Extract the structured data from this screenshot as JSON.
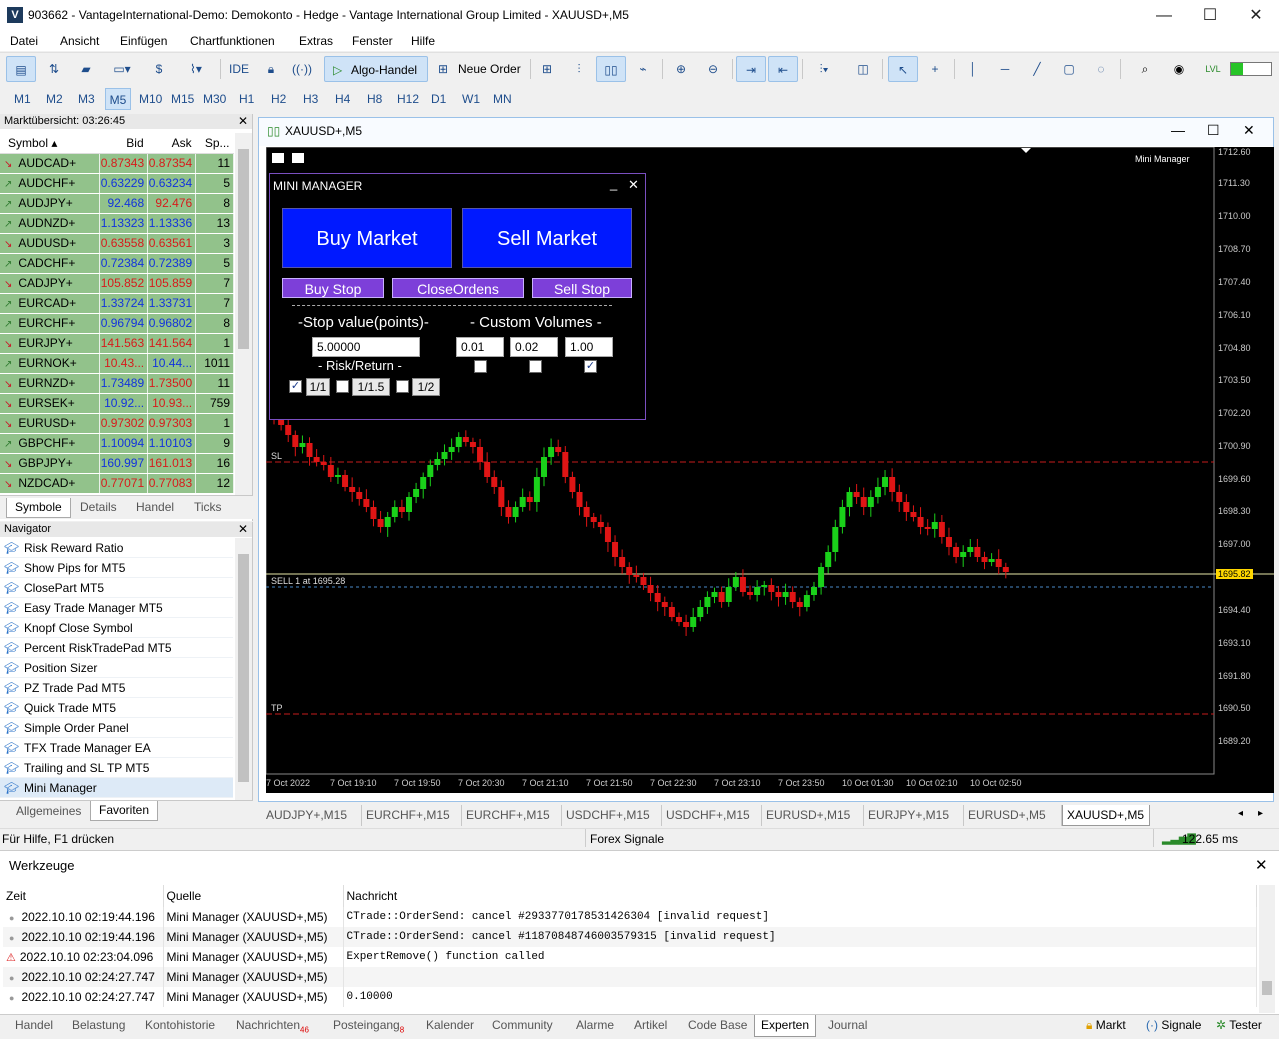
{
  "window": {
    "title": "903662 - VantageInternational-Demo: Demokonto - Hedge - Vantage International Group Limited - XAUUSD+,M5",
    "logo": "V"
  },
  "menu": [
    "Datei",
    "Ansicht",
    "Einfügen",
    "Chartfunktionen",
    "Extras",
    "Fenster",
    "Hilfe"
  ],
  "toolbar": {
    "ide": "IDE",
    "algo": "Algo-Handel",
    "neworder": "Neue Order"
  },
  "timeframes": [
    "M1",
    "M2",
    "M3",
    "M5",
    "M10",
    "M15",
    "M30",
    "H1",
    "H2",
    "H3",
    "H4",
    "H8",
    "H12",
    "D1",
    "W1",
    "MN"
  ],
  "market_watch": {
    "header": "Marktübersicht: 03:26:45",
    "columns": [
      "Symbol",
      "Bid",
      "Ask",
      "Sp..."
    ],
    "rows": [
      {
        "dir": "dn",
        "symbol": "AUDCAD+",
        "bid": "0.87343",
        "ask": "0.87354",
        "spread": "11",
        "bc": "dn",
        "ac": "dn"
      },
      {
        "dir": "up",
        "symbol": "AUDCHF+",
        "bid": "0.63229",
        "ask": "0.63234",
        "spread": "5",
        "bc": "up",
        "ac": "up"
      },
      {
        "dir": "up",
        "symbol": "AUDJPY+",
        "bid": "92.468",
        "ask": "92.476",
        "spread": "8",
        "bc": "up",
        "ac": "dn"
      },
      {
        "dir": "up",
        "symbol": "AUDNZD+",
        "bid": "1.13323",
        "ask": "1.13336",
        "spread": "13",
        "bc": "up",
        "ac": "up"
      },
      {
        "dir": "dn",
        "symbol": "AUDUSD+",
        "bid": "0.63558",
        "ask": "0.63561",
        "spread": "3",
        "bc": "dn",
        "ac": "dn"
      },
      {
        "dir": "up",
        "symbol": "CADCHF+",
        "bid": "0.72384",
        "ask": "0.72389",
        "spread": "5",
        "bc": "up",
        "ac": "up"
      },
      {
        "dir": "dn",
        "symbol": "CADJPY+",
        "bid": "105.852",
        "ask": "105.859",
        "spread": "7",
        "bc": "dn",
        "ac": "dn"
      },
      {
        "dir": "up",
        "symbol": "EURCAD+",
        "bid": "1.33724",
        "ask": "1.33731",
        "spread": "7",
        "bc": "up",
        "ac": "up"
      },
      {
        "dir": "up",
        "symbol": "EURCHF+",
        "bid": "0.96794",
        "ask": "0.96802",
        "spread": "8",
        "bc": "up",
        "ac": "up"
      },
      {
        "dir": "dn",
        "symbol": "EURJPY+",
        "bid": "141.563",
        "ask": "141.564",
        "spread": "1",
        "bc": "dn",
        "ac": "dn"
      },
      {
        "dir": "up",
        "symbol": "EURNOK+",
        "bid": "10.43...",
        "ask": "10.44...",
        "spread": "1011",
        "bc": "dn",
        "ac": "up"
      },
      {
        "dir": "dn",
        "symbol": "EURNZD+",
        "bid": "1.73489",
        "ask": "1.73500",
        "spread": "11",
        "bc": "up",
        "ac": "dn"
      },
      {
        "dir": "dn",
        "symbol": "EURSEK+",
        "bid": "10.92...",
        "ask": "10.93...",
        "spread": "759",
        "bc": "up",
        "ac": "dn"
      },
      {
        "dir": "dn",
        "symbol": "EURUSD+",
        "bid": "0.97302",
        "ask": "0.97303",
        "spread": "1",
        "bc": "dn",
        "ac": "dn"
      },
      {
        "dir": "up",
        "symbol": "GBPCHF+",
        "bid": "1.10094",
        "ask": "1.10103",
        "spread": "9",
        "bc": "up",
        "ac": "up"
      },
      {
        "dir": "dn",
        "symbol": "GBPJPY+",
        "bid": "160.997",
        "ask": "161.013",
        "spread": "16",
        "bc": "up",
        "ac": "dn"
      },
      {
        "dir": "dn",
        "symbol": "NZDCAD+",
        "bid": "0.77071",
        "ask": "0.77083",
        "spread": "12",
        "bc": "dn",
        "ac": "dn"
      }
    ],
    "tabs": [
      "Symbole",
      "Details",
      "Handel",
      "Ticks"
    ]
  },
  "navigator": {
    "header": "Navigator",
    "items": [
      "Risk Reward Ratio",
      "Show Pips for MT5",
      "ClosePart MT5",
      "Easy Trade Manager MT5",
      "Knopf Close Symbol",
      "Percent RiskTradePad MT5",
      "Position Sizer",
      "PZ Trade Pad MT5",
      "Quick Trade MT5",
      "Simple Order Panel",
      "TFX Trade Manager EA",
      "Trailing and SL TP MT5",
      "Mini Manager"
    ],
    "tabs": [
      "Allgemeines",
      "Favoriten"
    ]
  },
  "chart": {
    "title": "XAUUSD+,M5",
    "indicator_label": "Mini Manager",
    "sl_label": "SL",
    "tp_label": "TP",
    "sell_label": "SELL 1 at 1695.28",
    "current_price": "1695.82",
    "price_labels": [
      "1712.60",
      "1711.30",
      "1710.00",
      "1708.70",
      "1707.40",
      "1706.10",
      "1704.80",
      "1703.50",
      "1702.20",
      "1700.90",
      "1699.60",
      "1698.30",
      "1697.00",
      "1695.82",
      "1694.40",
      "1693.10",
      "1691.80",
      "1690.50",
      "1689.20"
    ],
    "time_labels": [
      "7 Oct 2022",
      "7 Oct 19:10",
      "7 Oct 19:50",
      "7 Oct 20:30",
      "7 Oct 21:10",
      "7 Oct 21:50",
      "7 Oct 22:30",
      "7 Oct 23:10",
      "7 Oct 23:50",
      "10 Oct 01:30",
      "10 Oct 02:10",
      "10 Oct 02:50"
    ]
  },
  "mini_manager": {
    "title": "MINI MANAGER",
    "buy_market": "Buy Market",
    "sell_market": "Sell Market",
    "buy_stop": "Buy Stop",
    "close_orders": "CloseOrdens",
    "sell_stop": "Sell Stop",
    "stop_label": "-Stop value(points)-",
    "stop_value": "5.00000",
    "volumes_label": "- Custom Volumes -",
    "volumes": [
      "0.01",
      "0.02",
      "1.00"
    ],
    "risk_label": "- Risk/Return -",
    "ratios": [
      "1/1",
      "1/1.5",
      "1/2"
    ]
  },
  "chart_tabs": [
    "AUDJPY+,M15",
    "EURCHF+,M15",
    "EURCHF+,M15",
    "USDCHF+,M15",
    "USDCHF+,M15",
    "EURUSD+,M15",
    "EURJPY+,M15",
    "EURUSD+,M5",
    "XAUUSD+,M5"
  ],
  "status": {
    "help": "Für Hilfe, F1 drücken",
    "signals": "Forex Signale",
    "ping": "122.65 ms"
  },
  "tools": {
    "title": "Werkzeuge",
    "columns": [
      "Zeit",
      "Quelle",
      "Nachricht"
    ],
    "rows": [
      {
        "time": "2022.10.10 02:19:44.196",
        "source": "Mini Manager (XAUUSD+,M5)",
        "msg": "CTrade::OrderSend: cancel #2933770178531426304 [invalid request]",
        "warn": false
      },
      {
        "time": "2022.10.10 02:19:44.196",
        "source": "Mini Manager (XAUUSD+,M5)",
        "msg": "CTrade::OrderSend: cancel #11870848746003579315 [invalid request]",
        "warn": false
      },
      {
        "time": "2022.10.10 02:23:04.096",
        "source": "Mini Manager (XAUUSD+,M5)",
        "msg": "ExpertRemove() function called",
        "warn": true
      },
      {
        "time": "2022.10.10 02:24:27.747",
        "source": "Mini Manager (XAUUSD+,M5)",
        "msg": "",
        "warn": false
      },
      {
        "time": "2022.10.10 02:24:27.747",
        "source": "Mini Manager (XAUUSD+,M5)",
        "msg": "0.10000",
        "warn": false
      }
    ]
  },
  "bottom_tabs": {
    "handel": "Handel",
    "belastung": "Belastung",
    "konto": "Kontohistorie",
    "nachrichten": "Nachrichten",
    "nachrichten_badge": "46",
    "post": "Posteingang",
    "post_badge": "8",
    "kalender": "Kalender",
    "community": "Community",
    "alarme": "Alarme",
    "artikel": "Artikel",
    "codebase": "Code Base",
    "experten": "Experten",
    "journal": "Journal",
    "markt": "Markt",
    "signale": "Signale",
    "tester": "Tester"
  }
}
